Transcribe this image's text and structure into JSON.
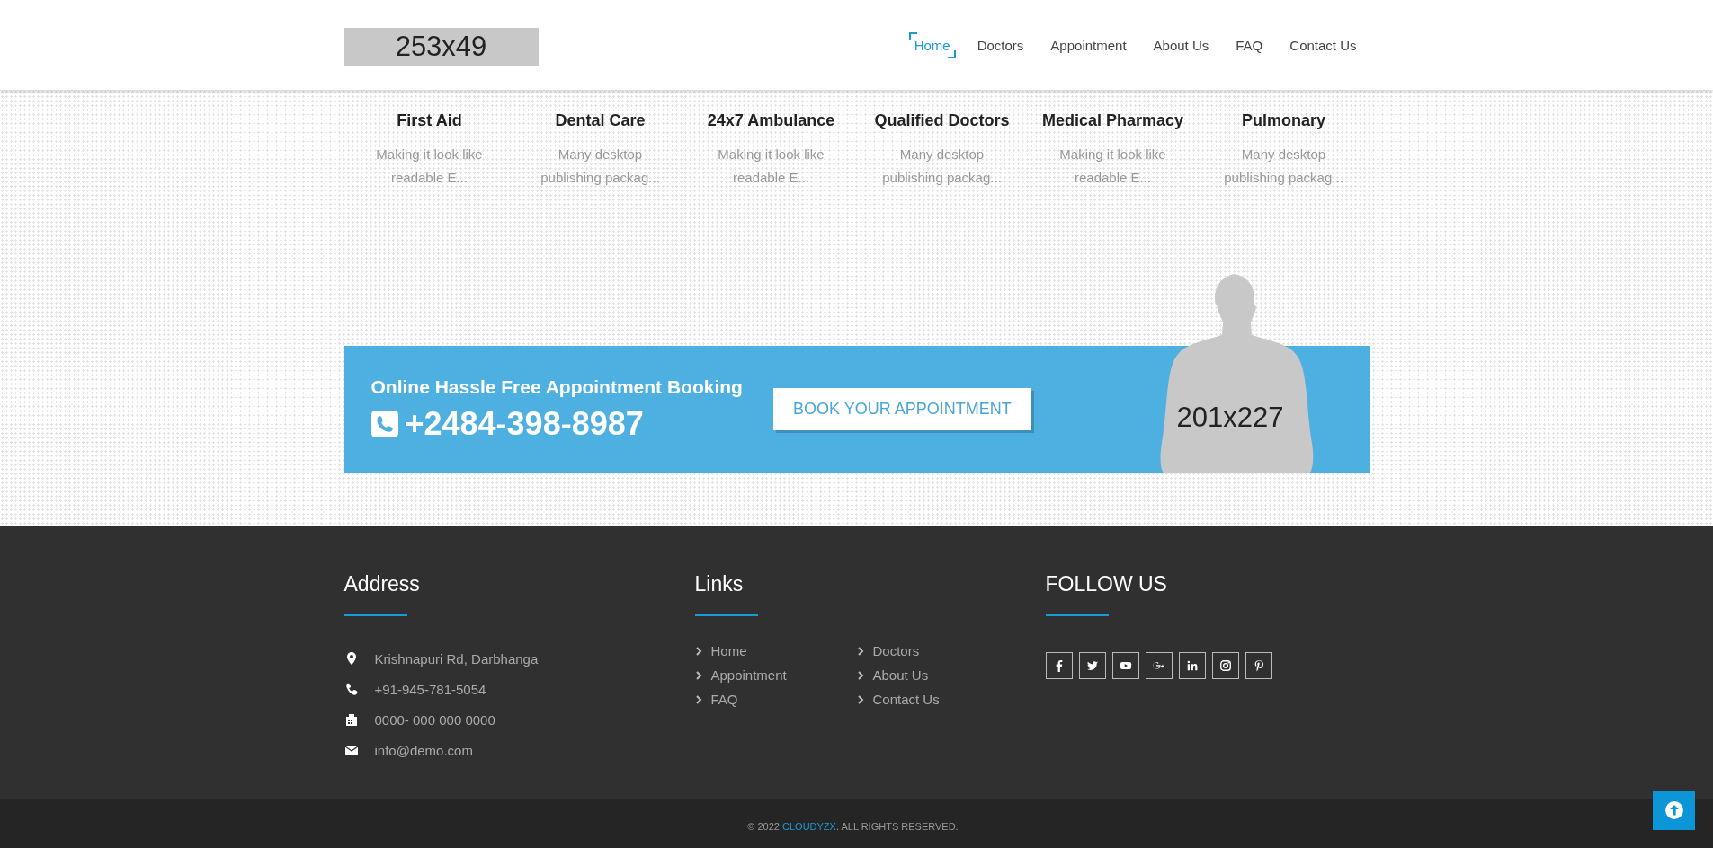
{
  "header": {
    "logo": "253x49",
    "nav": [
      {
        "label": "Home",
        "selected": true
      },
      {
        "label": "Doctors",
        "selected": false
      },
      {
        "label": "Appointment",
        "selected": false
      },
      {
        "label": "About Us",
        "selected": false
      },
      {
        "label": "FAQ",
        "selected": false
      },
      {
        "label": "Contact Us",
        "selected": false
      }
    ]
  },
  "services": [
    {
      "title": "First Aid",
      "text": "Making it look like readable E..."
    },
    {
      "title": "Dental Care",
      "text": "Many desktop publishing packag..."
    },
    {
      "title": "24x7 Ambulance",
      "text": "Making it look like readable E..."
    },
    {
      "title": "Qualified Doctors",
      "text": "Many desktop publishing packag..."
    },
    {
      "title": "Medical Pharmacy",
      "text": "Making it look like readable E..."
    },
    {
      "title": "Pulmonary",
      "text": "Many desktop publishing packag..."
    }
  ],
  "banner": {
    "heading": "Online Hassle Free Appointment Booking",
    "phone": "+2484-398-8987",
    "button": "BOOK YOUR APPOINTMENT",
    "image_label": "201x227"
  },
  "footer": {
    "address": {
      "title": "Address",
      "items": [
        {
          "kind": "pin",
          "text": "Krishnapuri Rd, Darbhanga"
        },
        {
          "kind": "phone",
          "text": "+91-945-781-5054"
        },
        {
          "kind": "fax",
          "text": "0000- 000 000 0000"
        },
        {
          "kind": "mail",
          "text": "info@demo.com"
        }
      ]
    },
    "links": {
      "title": "Links",
      "items": [
        "Home",
        "Doctors",
        "Appointment",
        "About Us",
        "FAQ",
        "Contact Us"
      ]
    },
    "follow": {
      "title": "FOLLOW US",
      "icons": [
        {
          "kind": "facebook"
        },
        {
          "kind": "twitter"
        },
        {
          "kind": "youtube"
        },
        {
          "kind": "google-plus"
        },
        {
          "kind": "linkedin"
        },
        {
          "kind": "instagram"
        },
        {
          "kind": "pinterest"
        }
      ]
    }
  },
  "copyright": {
    "prefix": "© 2022 ",
    "brand": "CLOUDYZX",
    "suffix": ". ALL RIGHTS RESERVED."
  }
}
